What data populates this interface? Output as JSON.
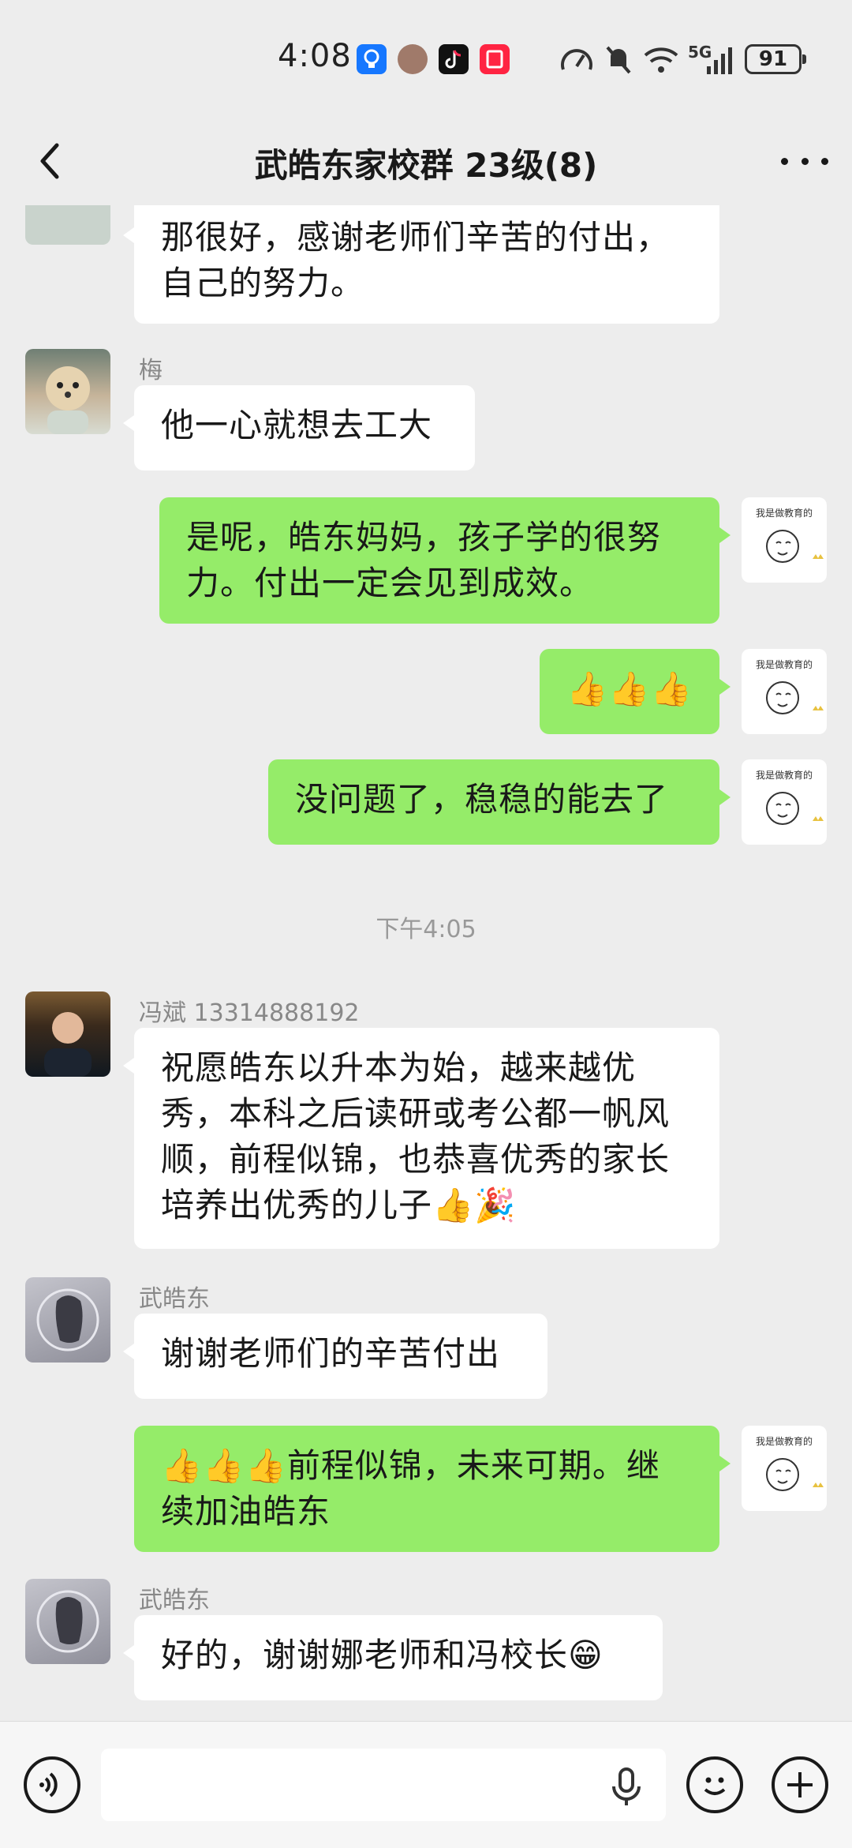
{
  "status_bar": {
    "time": "4:08",
    "battery": "91",
    "network": "5G"
  },
  "header": {
    "title": "武皓东家校群 23级(8)"
  },
  "messages": {
    "m1": {
      "text_line1": "那很好，感谢老师们辛苦的付出，",
      "text_line2": "自己的努力。"
    },
    "m2": {
      "sender": "梅",
      "text": "他一心就想去工大"
    },
    "m3": {
      "text_line1": "是呢，皓东妈妈，孩子学的很努",
      "text_line2": "力。付出一定会见到成效。"
    },
    "m4": {
      "text": "👍👍👍"
    },
    "m5": {
      "text": "没问题了，稳稳的能去了"
    },
    "timestamp": "下午4:05",
    "m6": {
      "sender": "冯斌 13314888192",
      "line1": "祝愿皓东以升本为始，越来越优",
      "line2": "秀，本科之后读研或考公都一帆风",
      "line3": "顺，前程似锦，也恭喜优秀的家长",
      "line4": "培养出优秀的儿子👍🎉"
    },
    "m7": {
      "sender": "武皓东",
      "text": "谢谢老师们的辛苦付出"
    },
    "m8": {
      "line1": "👍👍👍前程似锦，未来可期。继",
      "line2": "续加油皓东"
    },
    "m9": {
      "sender": "武皓东",
      "text": "好的，谢谢娜老师和冯校长😁"
    }
  },
  "sticker_text": "我是做教育的",
  "icons": [
    "back-icon",
    "more-icon",
    "voice-icon",
    "mic-icon",
    "emoji-icon",
    "plus-icon"
  ],
  "colors": {
    "outgoing_bubble": "#95ec69",
    "incoming_bubble": "#ffffff",
    "background": "#ededed"
  }
}
